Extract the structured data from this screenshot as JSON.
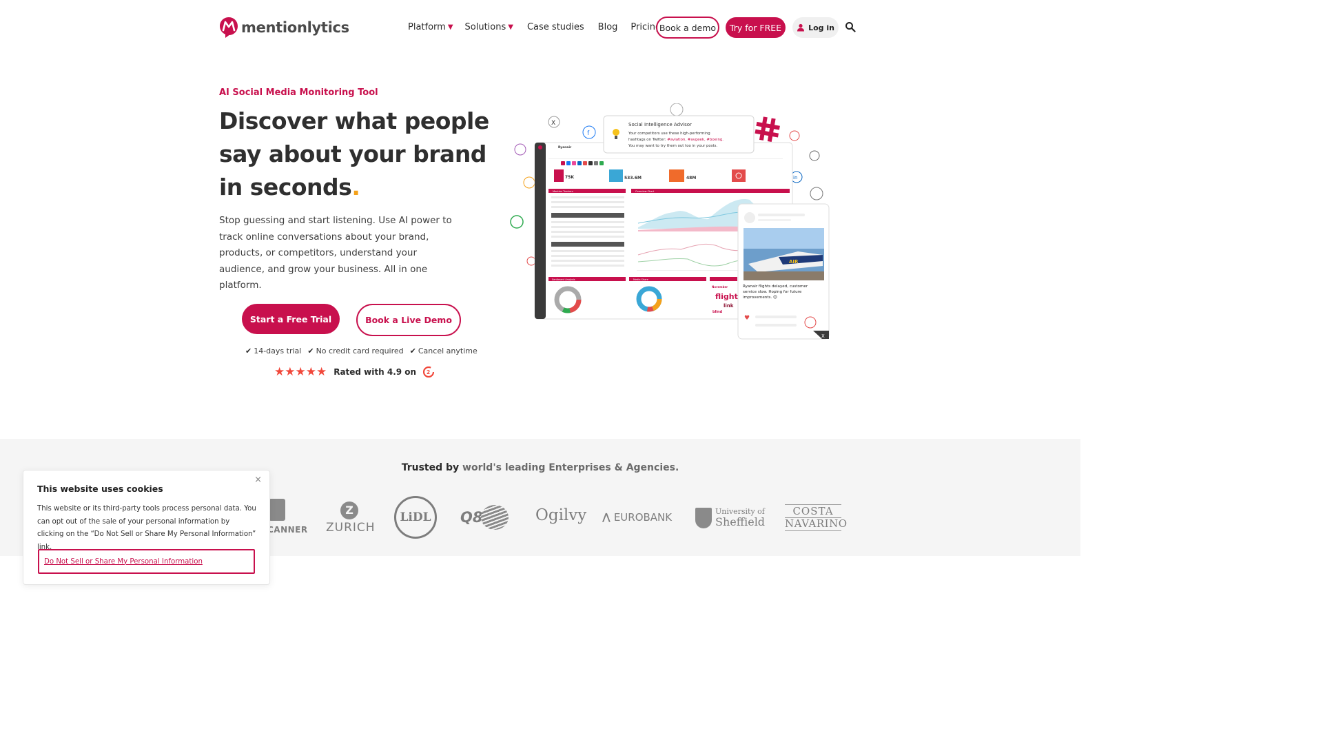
{
  "brand": {
    "name": "mentionlytics",
    "accent": "#c8104d",
    "highlight": "#f4a11a",
    "star_color": "#f1483b"
  },
  "nav": {
    "items": [
      {
        "label": "Platform",
        "caret": "▼"
      },
      {
        "label": "Solutions",
        "caret": "▼"
      },
      {
        "label": "Case studies"
      },
      {
        "label": "Blog"
      },
      {
        "label": "Pricing"
      }
    ],
    "book_demo": "Book a demo",
    "try_free": "Try for FREE",
    "login": "Log in",
    "search_icon": "search-icon"
  },
  "hero": {
    "eyebrow": "AI Social Media Monitoring Tool",
    "title": "Discover what people say about your brand in seconds",
    "title_dot": ".",
    "description": "Stop guessing and start listening. Use AI power to track online conversations about your brand, products, or competitors, understand your audience, and grow your business. All in one platform.",
    "cta_primary": "Start a Free Trial",
    "cta_secondary": "Book a Live Demo",
    "perks": [
      "14-days trial",
      "No credit card required",
      "Cancel anytime"
    ],
    "stars": "★★★★★",
    "rating_text": "Rated with 4.9 on"
  },
  "illustration": {
    "advisor_title": "Social Intelligence Advisor",
    "advisor_line1": "Your competitors use these high-performing",
    "advisor_line2_prefix": "hashtags on Twitter: ",
    "advisor_hashtags": "#aviation, #avgeek, #boeing.",
    "advisor_line3": "You may want to try them out too in your posts.",
    "dashboard_brand": "Ryanair",
    "kpis": [
      "75K",
      "533.6M",
      "48M"
    ],
    "panel_trackers": "Mention Trackers",
    "panel_chart": "Overview Chart",
    "panel_sentiment": "Sentiment Analysis",
    "panel_share": "Media Share",
    "word_cloud": [
      "flight",
      "link",
      "blind",
      "November"
    ],
    "post_text": "Ryanair flights delayed, customer service slow. Hoping for future improvements.",
    "post_emoji": "😊",
    "plane_label": "AIR"
  },
  "trusted": {
    "prefix": "Trusted by",
    "suffix": "world's leading Enterprises & Agencies.",
    "logos": {
      "skyscanner": "CANNER",
      "zurich": "ZURICH",
      "lidl": "LiDL",
      "q8": "Q8",
      "ogilvy": "Ogilvy",
      "eurobank": "EUROBANK",
      "sheffield_1": "University of",
      "sheffield_2": "Sheffield",
      "costa_1": "COSTA",
      "costa_2": "NAVARINO"
    }
  },
  "cookie": {
    "title": "This website uses cookies",
    "close": "×",
    "text": "This website or its third-party tools process personal data. You can opt out of the sale of your personal information by clicking on the “Do Not Sell or Share My Personal Information” link.",
    "button": "Do Not Sell or Share My Personal Information"
  }
}
